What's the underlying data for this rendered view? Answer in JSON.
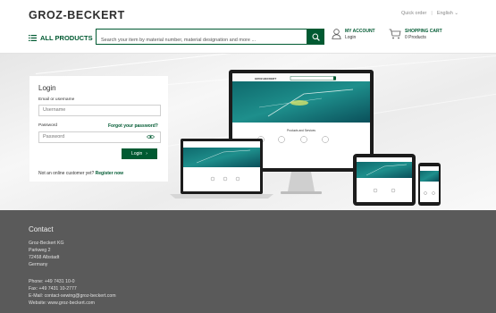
{
  "header": {
    "logo": "GROZ-BECKERT",
    "quick_order": "Quick order",
    "language": "English",
    "all_products": "ALL PRODUCTS",
    "search_placeholder": "Search your item by material number, material designation and more ...",
    "account_title": "MY ACCOUNT",
    "account_sub": "Login",
    "cart_title": "SHOPPING CART",
    "cart_sub": "0 Products"
  },
  "login": {
    "title": "Login",
    "email_label": "Email or username",
    "username_placeholder": "Username",
    "password_label": "Password",
    "forgot": "Forgot your password?",
    "password_placeholder": "Password",
    "button": "Login",
    "not_customer": "Not an online customer yet?",
    "register": "Register now"
  },
  "devices": {
    "site_heading": "Products and Services"
  },
  "footer": {
    "title": "Contact",
    "address": [
      "Groz-Beckert KG",
      "Parkweg 2",
      "72458 Albstadt",
      "Germany"
    ],
    "contact": [
      "Phone: +49 7431 10-0",
      "Fax: +49 7431 10-2777",
      "E-Mail: contact-sewing@groz-beckert.com",
      "Website: www.groz-beckert.com"
    ]
  },
  "colors": {
    "brand_green": "#005a32",
    "footer_bg": "#5a5a5a",
    "hero_bg": "#efefef"
  }
}
